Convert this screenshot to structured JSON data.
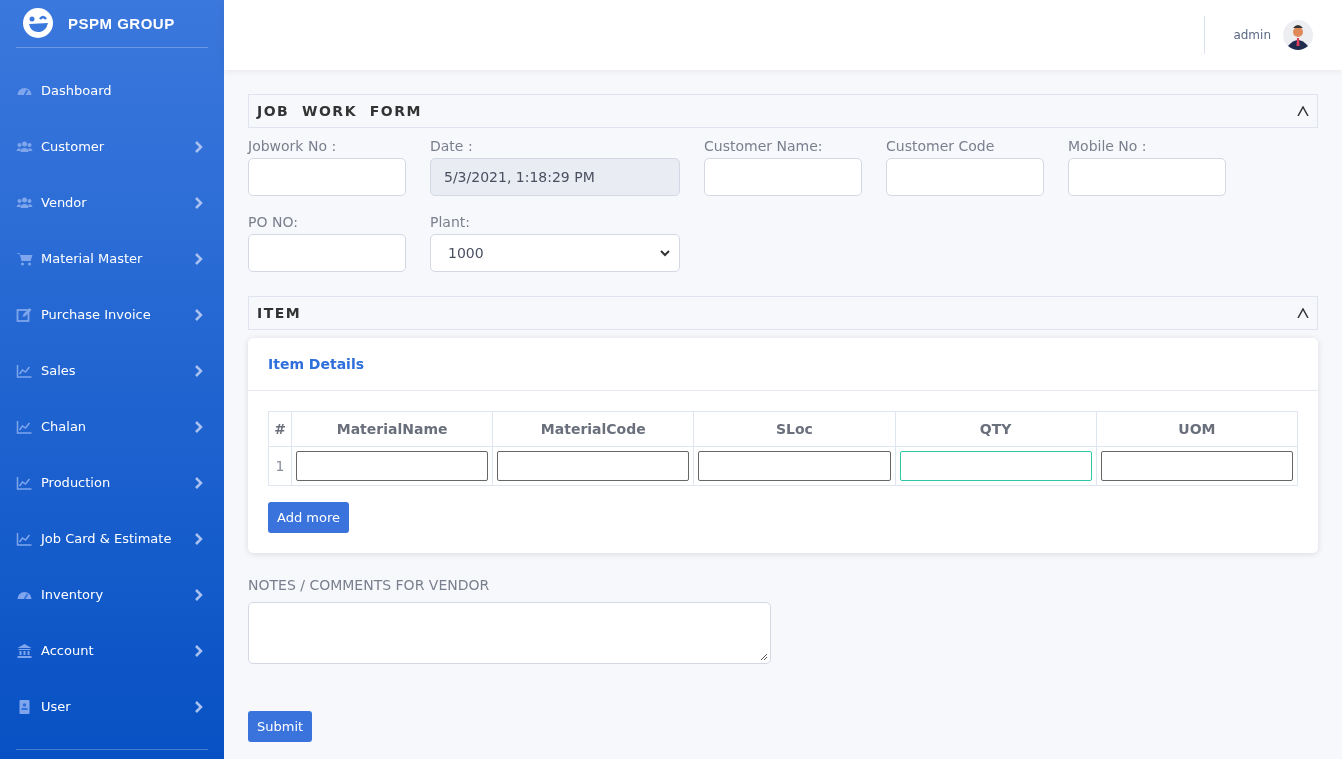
{
  "sidebar": {
    "brand": "PSPM GROUP",
    "items": [
      {
        "label": "Dashboard",
        "kind": "gauge",
        "expandable": false
      },
      {
        "label": "Customer",
        "kind": "users",
        "expandable": true
      },
      {
        "label": "Vendor",
        "kind": "users",
        "expandable": true
      },
      {
        "label": "Material Master",
        "kind": "cart",
        "expandable": true
      },
      {
        "label": "Purchase Invoice",
        "kind": "edit",
        "expandable": true
      },
      {
        "label": "Sales",
        "kind": "chart",
        "expandable": true
      },
      {
        "label": "Chalan",
        "kind": "chart",
        "expandable": true
      },
      {
        "label": "Production",
        "kind": "chart",
        "expandable": true
      },
      {
        "label": "Job Card & Estimate",
        "kind": "chart",
        "expandable": true
      },
      {
        "label": "Inventory",
        "kind": "gauge",
        "expandable": true
      },
      {
        "label": "Account",
        "kind": "bank",
        "expandable": true
      },
      {
        "label": "User",
        "kind": "idcard",
        "expandable": true
      }
    ]
  },
  "header": {
    "user": "admin"
  },
  "job_work_form": {
    "title": "JOB  WORK  FORM",
    "expanded": true,
    "fields": [
      {
        "label": "Jobwork No :",
        "kind": "text",
        "disabled": false
      },
      {
        "label": "Date :",
        "kind": "text",
        "value": "5/3/2021, 1:18:29 PM",
        "disabled": true
      },
      {
        "label": "Customer Name:",
        "kind": "text",
        "disabled": false
      },
      {
        "label": "Customer Code",
        "kind": "text",
        "disabled": false
      },
      {
        "label": "Mobile No :",
        "kind": "text",
        "disabled": false
      },
      {
        "label": "PO NO:",
        "kind": "text",
        "disabled": false
      },
      {
        "label": "Plant:",
        "kind": "select",
        "value": "1000",
        "disabled": false
      }
    ]
  },
  "item_section": {
    "title": "ITEM",
    "expanded": true,
    "card_title": "Item Details",
    "table": {
      "columns": [
        "#",
        "MaterialName",
        "MaterialCode",
        "SLoc",
        "QTY",
        "UOM"
      ],
      "rows": [
        {
          "number": "1",
          "cells": [
            {
              "focused": false
            },
            {
              "focused": false
            },
            {
              "focused": false
            },
            {
              "focused": true
            },
            {
              "focused": false
            }
          ]
        }
      ]
    },
    "add_button": "Add more"
  },
  "notes": {
    "label": "NOTES / COMMENTS FOR VENDOR"
  },
  "submit": "Submit"
}
